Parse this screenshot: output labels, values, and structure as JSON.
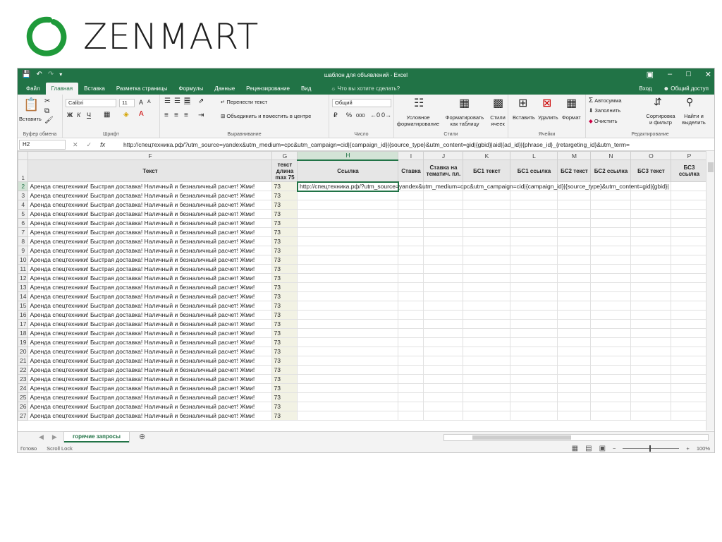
{
  "logo": {
    "text": "ZENMART",
    "color": "#1f9a3a"
  },
  "window": {
    "title": "шаблон для объявлений - Excel",
    "accent": "#217346",
    "quick_access": {
      "save_icon": "save-icon",
      "undo_icon": "undo-icon",
      "redo_icon": "redo-icon",
      "customize_icon": "chevron-down-icon"
    },
    "controls": {
      "restore_ribbon": "▣",
      "minimize": "–",
      "maximize": "□",
      "close": "✕"
    }
  },
  "ribbon_tabs": {
    "items": [
      "Файл",
      "Главная",
      "Вставка",
      "Разметка страницы",
      "Формулы",
      "Данные",
      "Рецензирование",
      "Вид"
    ],
    "active": "Главная",
    "tell_me": "Что вы хотите сделать?",
    "sign_in": "Вход",
    "share": "Общий доступ"
  },
  "ribbon": {
    "clipboard": {
      "paste": "Вставить",
      "label": "Буфер обмена"
    },
    "font": {
      "name": "Calibri",
      "size": "11",
      "bold": "Ж",
      "italic": "К",
      "underline": "Ч",
      "grow": "A",
      "shrink": "A",
      "label": "Шрифт"
    },
    "alignment": {
      "wrap": "Перенести текст",
      "merge": "Объединить и поместить в центре",
      "label": "Выравнивание"
    },
    "number": {
      "format": "Общий",
      "percent": "%",
      "thousands": "000",
      "label": "Число"
    },
    "styles": {
      "conditional": "Условное форматирование",
      "table": "Форматировать как таблицу",
      "cell_styles": "Стили ячеек",
      "label": "Стили"
    },
    "cells": {
      "insert": "Вставить",
      "delete": "Удалить",
      "format": "Формат",
      "label": "Ячейки"
    },
    "editing": {
      "autosum": "Автосумма",
      "fill": "Заполнить",
      "clear": "Очистить",
      "sort": "Сортировка и фильтр",
      "find": "Найти и выделить",
      "label": "Редактирование"
    }
  },
  "formula_bar": {
    "name_box": "H2",
    "fx": "fx",
    "value": "http://спецтехника.рф/?utm_source=yandex&utm_medium=cpc&utm_campaign=cid|{campaign_id}|{source_type}&utm_content=gid|{gbid}|aid|{ad_id}|{phrase_id}_{retargeting_id}&utm_term="
  },
  "grid": {
    "columns": [
      "F",
      "G",
      "H",
      "I",
      "J",
      "K",
      "L",
      "M",
      "N",
      "O",
      "P"
    ],
    "selected_column": "H",
    "selected_row": "2",
    "headers": [
      "Текст",
      "текст длина max 75",
      "Ссылка",
      "Ставка",
      "Ставка на тематич. пл.",
      "БС1 текст",
      "БС1 ссылка",
      "БС2 текст",
      "БС2 ссылка",
      "БС3 текст",
      "БС3 ссылка"
    ],
    "header_row_number": "1",
    "row_numbers": [
      "2",
      "3",
      "4",
      "5",
      "6",
      "7",
      "8",
      "9",
      "10",
      "11",
      "12",
      "13",
      "14",
      "15",
      "16",
      "17",
      "18",
      "19",
      "20",
      "21",
      "22",
      "23",
      "24",
      "25",
      "26",
      "27"
    ],
    "row_text": "Аренда спецтехники! Быстрая доставка! Наличный и безналичный расчет! Жми!",
    "row_length": "73",
    "active_cell_value": "http://спецтехника.рф/?utm_source=yandex&utm_medium=cpc&utm_campaign=cid|{campaign_id}|{source_type}&utm_content=gid|{gbid}|"
  },
  "sheets": {
    "active": "горячие запросы",
    "add": "⊕"
  },
  "status": {
    "ready": "Готово",
    "scroll_lock": "Scroll Lock",
    "zoom": "100%"
  }
}
